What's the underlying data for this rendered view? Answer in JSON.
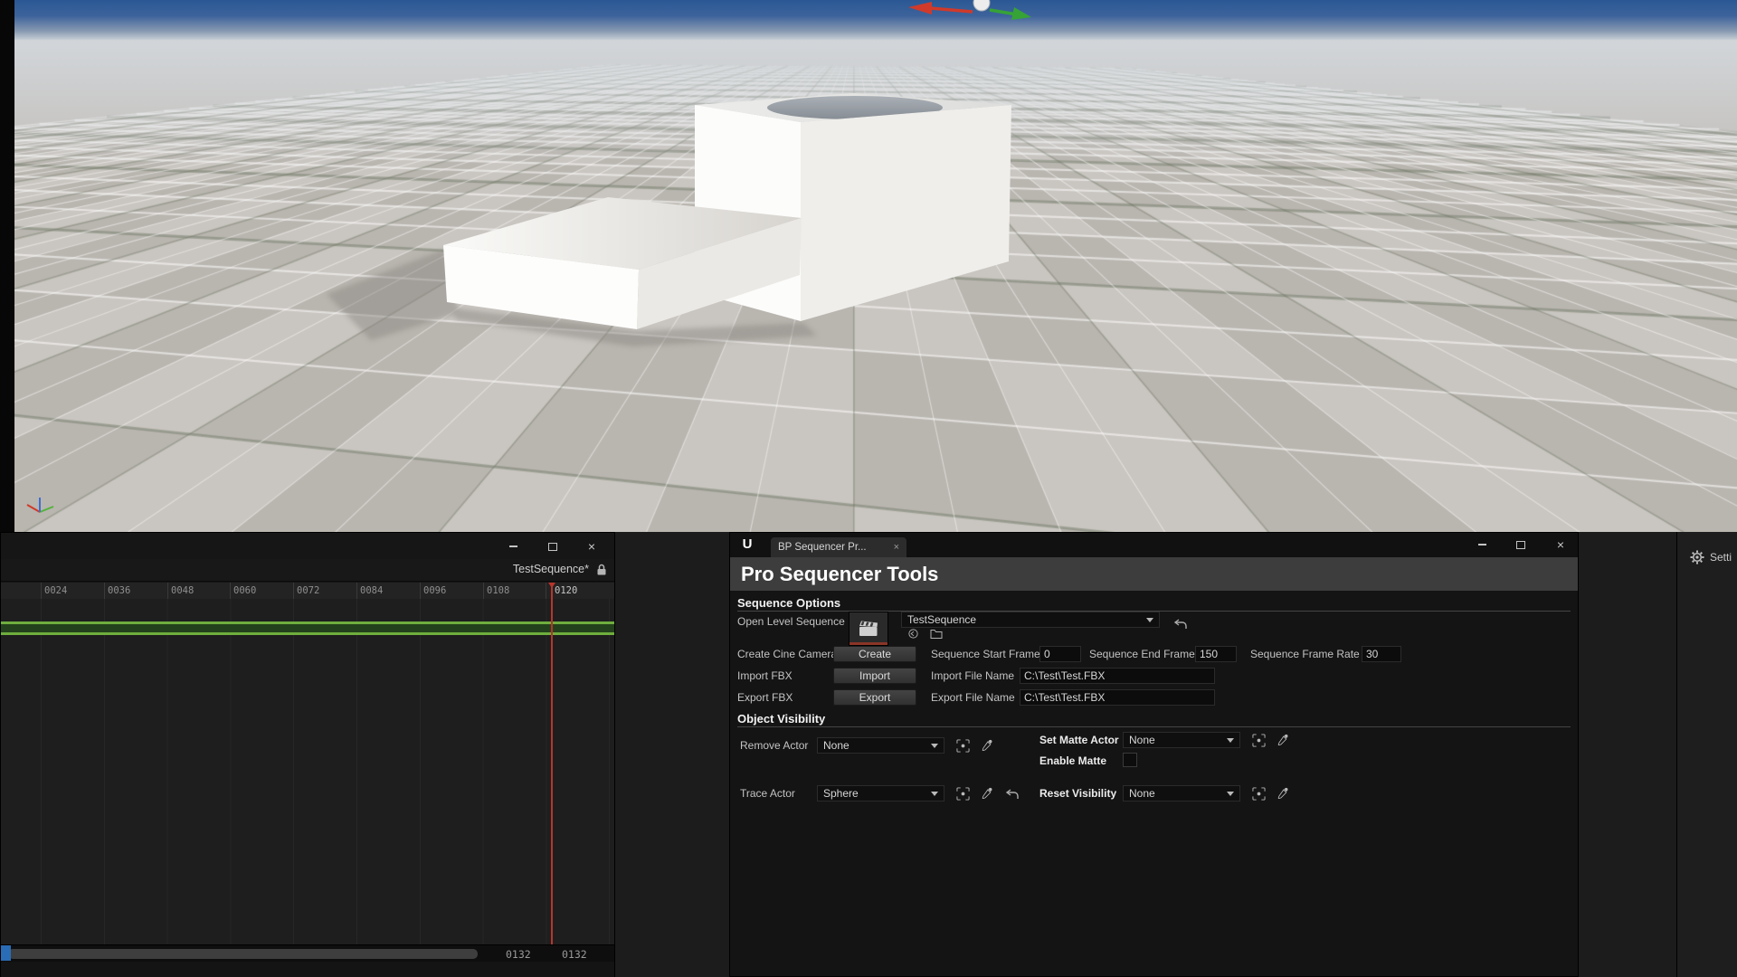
{
  "glyphs": {
    "close": "×"
  },
  "sequencer": {
    "title": "TestSequence*",
    "ruler_labels": [
      "0024",
      "0036",
      "0048",
      "0060",
      "0072",
      "0084",
      "0096",
      "0108",
      "0120"
    ],
    "current_end": "0132",
    "total": "0132"
  },
  "tools": {
    "logo": "U",
    "tab": "BP Sequencer Pr...",
    "title": "Pro Sequencer Tools",
    "sections": {
      "sequence_options": "Sequence Options",
      "object_visibility": "Object Visibility"
    },
    "open_level_sequence": {
      "label": "Open Level Sequence",
      "value": "TestSequence"
    },
    "create_cine_camera": {
      "label": "Create Cine Camera",
      "button": "Create"
    },
    "sequence_start_frame": {
      "label": "Sequence Start Frame",
      "value": "0"
    },
    "sequence_end_frame": {
      "label": "Sequence End Frame",
      "value": "150"
    },
    "sequence_frame_rate": {
      "label": "Sequence Frame Rate",
      "value": "30"
    },
    "import_fbx": {
      "label": "Import FBX",
      "button": "Import"
    },
    "import_file_name": {
      "label": "Import File Name",
      "value": "C:\\Test\\Test.FBX"
    },
    "export_fbx": {
      "label": "Export FBX",
      "button": "Export"
    },
    "export_file_name": {
      "label": "Export File Name",
      "value": "C:\\Test\\Test.FBX"
    },
    "remove_actor": {
      "label": "Remove Actor",
      "value": "None"
    },
    "set_matte_actor": {
      "label": "Set Matte Actor",
      "value": "None"
    },
    "enable_matte": {
      "label": "Enable Matte"
    },
    "trace_actor": {
      "label": "Trace Actor",
      "value": "Sphere"
    },
    "reset_visibility": {
      "label": "Reset Visibility",
      "value": "None"
    }
  },
  "right_panel": {
    "label": "Setti"
  }
}
